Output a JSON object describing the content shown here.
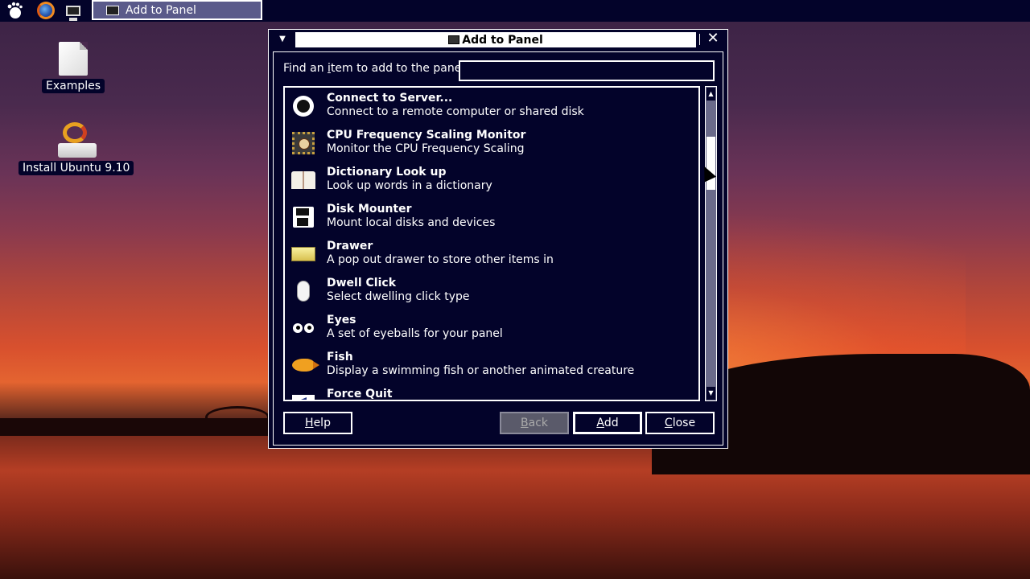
{
  "panel": {
    "taskbar_window_title": "Add to Panel"
  },
  "desktop": {
    "icons": [
      {
        "label": "Examples"
      },
      {
        "label": "Install Ubuntu 9.10"
      }
    ]
  },
  "dialog": {
    "title": "Add to Panel",
    "find_label_pre": "Find an ",
    "find_label_underlined": "i",
    "find_label_post": "tem to add to the panel:",
    "find_value": "",
    "items": [
      {
        "title": "Connect to Server...",
        "desc": "Connect to a remote computer or shared disk",
        "icon": "globe-icon"
      },
      {
        "title": "CPU Frequency Scaling Monitor",
        "desc": "Monitor the CPU Frequency Scaling",
        "icon": "cpu-monitor-icon"
      },
      {
        "title": "Dictionary Look up",
        "desc": "Look up words in a dictionary",
        "icon": "dictionary-icon"
      },
      {
        "title": "Disk Mounter",
        "desc": "Mount local disks and devices",
        "icon": "floppy-disk-icon"
      },
      {
        "title": "Drawer",
        "desc": "A pop out drawer to store other items in",
        "icon": "drawer-icon"
      },
      {
        "title": "Dwell Click",
        "desc": "Select dwelling click type",
        "icon": "mouse-icon"
      },
      {
        "title": "Eyes",
        "desc": "A set of eyeballs for your panel",
        "icon": "eyes-icon"
      },
      {
        "title": "Fish",
        "desc": "Display a swimming fish or another animated creature",
        "icon": "fish-icon"
      },
      {
        "title": "Force Quit",
        "desc": "",
        "icon": "force-quit-icon"
      }
    ],
    "buttons": {
      "help_u": "H",
      "help_rest": "elp",
      "back_u": "B",
      "back_rest": "ack",
      "add_u": "A",
      "add_rest": "dd",
      "close_u": "C",
      "close_rest": "lose"
    }
  }
}
